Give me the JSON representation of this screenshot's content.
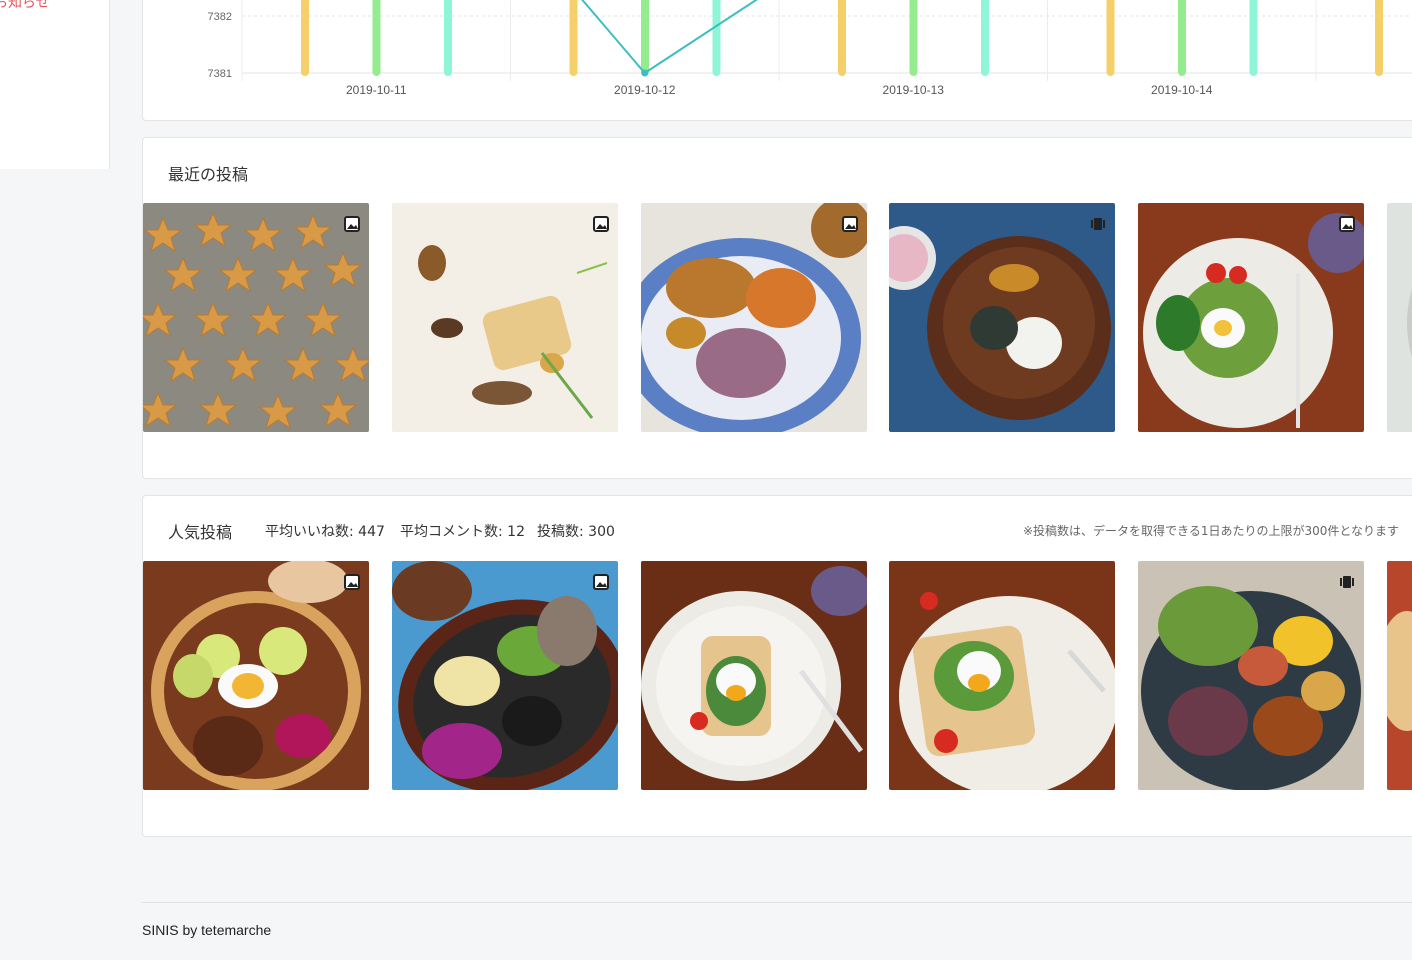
{
  "sidebar": {
    "partial_link": "お知らせ"
  },
  "chart_data": {
    "type": "bar",
    "title": "",
    "xlabel": "",
    "ylabel": "",
    "x_tick_labels": [
      "2019-10-11",
      "2019-10-12",
      "2019-10-13",
      "2019-10-14"
    ],
    "y_tick_labels": [
      "7382",
      "7381"
    ],
    "ylim": [
      7381,
      7382.4
    ],
    "grid": true,
    "bar_groups": [
      {
        "colors": [
          "#f5cf6a",
          "#95ec8f",
          "#8ef5d6"
        ]
      },
      {
        "colors": [
          "#f5cf6a",
          "#95ec8f",
          "#8ef5d6"
        ]
      },
      {
        "colors": [
          "#f5cf6a",
          "#95ec8f",
          "#8ef5d6"
        ]
      },
      {
        "colors": [
          "#f5cf6a",
          "#95ec8f",
          "#8ef5d6"
        ]
      },
      {
        "colors": [
          "#f5cf6a"
        ]
      }
    ],
    "line_series": {
      "color": "#3cbfbf",
      "points": [
        {
          "x": "2019-10-12",
          "y": 7381
        },
        {
          "x": "2019-10-12 12:00",
          "y": 7382.3
        }
      ]
    }
  },
  "recent_posts": {
    "title": "最近の投稿",
    "items": [
      {
        "name": "star-cookies",
        "badge": "image-icon"
      },
      {
        "name": "plated-fish-dish",
        "badge": "image-icon"
      },
      {
        "name": "japanese-plate-lunch",
        "badge": "image-icon"
      },
      {
        "name": "wooden-bowl-rice",
        "badge": "video-icon"
      },
      {
        "name": "avocado-toast-egg",
        "badge": "image-icon"
      },
      {
        "name": "partial-post",
        "badge": ""
      }
    ]
  },
  "popular_posts": {
    "title": "人気投稿",
    "avg_likes": "平均いいね数: 447",
    "avg_comments": "平均コメント数: 12",
    "post_count": "投稿数: 300",
    "note": "※投稿数は、データを取得できる1日あたりの上限が300件となります",
    "items": [
      {
        "name": "bento-box-egg",
        "badge": "image-icon"
      },
      {
        "name": "oval-bento-rice",
        "badge": "image-icon"
      },
      {
        "name": "poached-egg-toast-1",
        "badge": ""
      },
      {
        "name": "poached-egg-toast-2",
        "badge": ""
      },
      {
        "name": "salad-plate-rice",
        "badge": "video-icon"
      },
      {
        "name": "partial-post",
        "badge": ""
      }
    ]
  },
  "footer": {
    "text": "SINIS by tetemarche"
  }
}
